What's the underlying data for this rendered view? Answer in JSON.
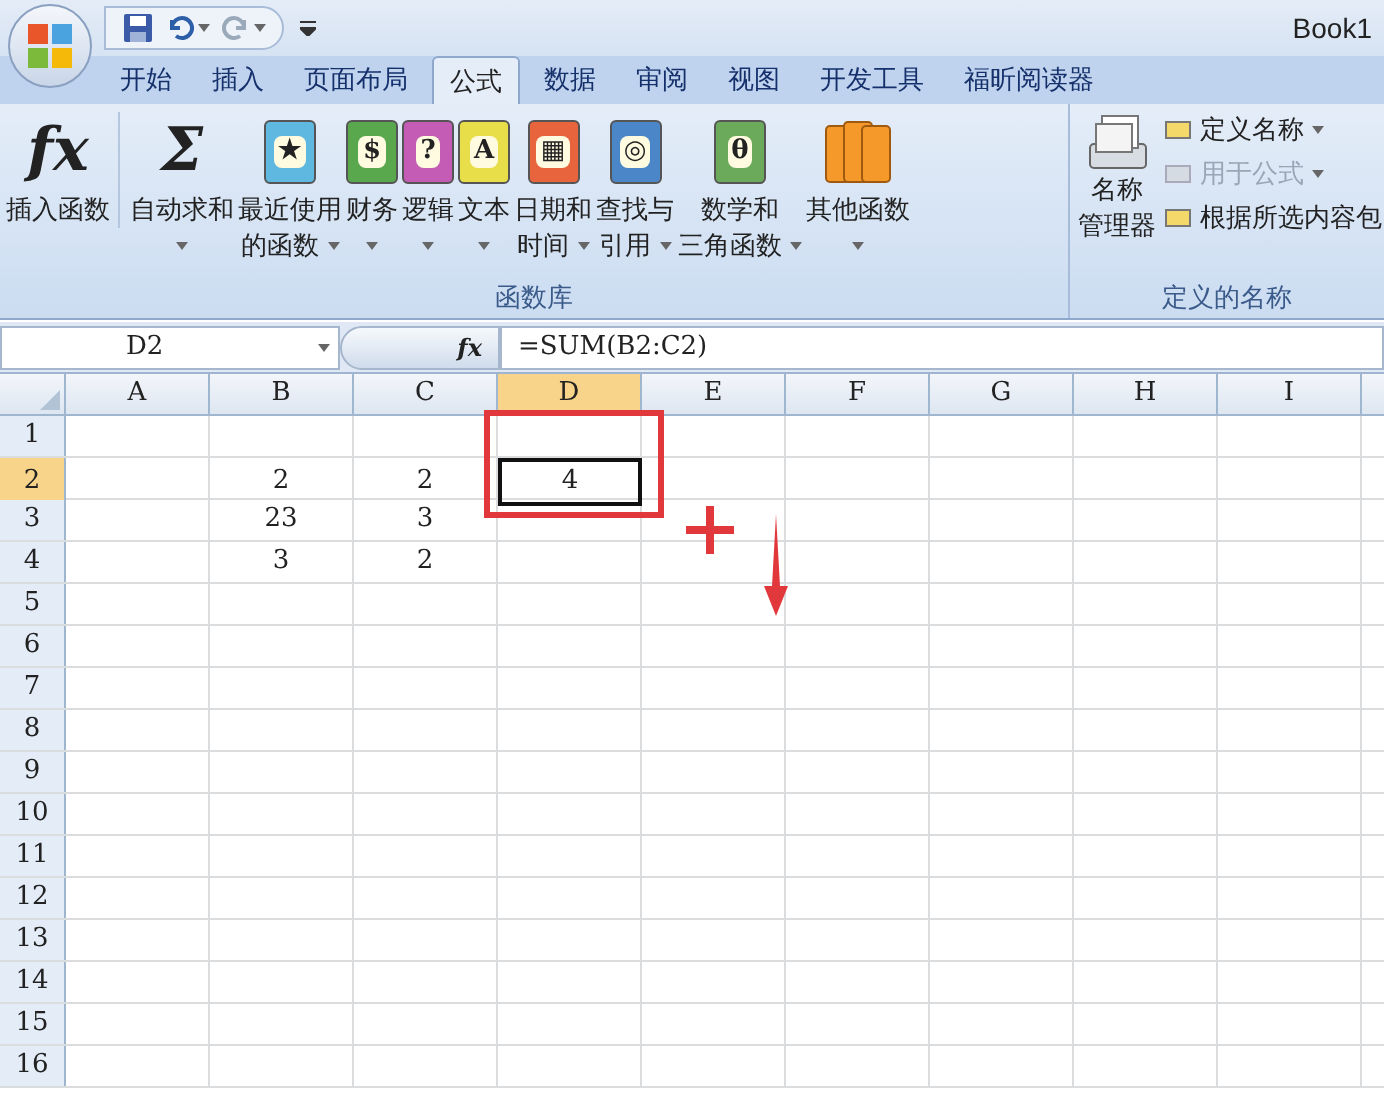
{
  "window": {
    "title": "Book1"
  },
  "quick_access": [
    {
      "kind": "save"
    },
    {
      "kind": "undo",
      "disabled": false
    },
    {
      "kind": "redo",
      "disabled": true
    }
  ],
  "tabs": [
    {
      "label": "开始",
      "selected": false
    },
    {
      "label": "插入",
      "selected": false
    },
    {
      "label": "页面布局",
      "selected": false
    },
    {
      "label": "公式",
      "selected": true
    },
    {
      "label": "数据",
      "selected": false
    },
    {
      "label": "审阅",
      "selected": false
    },
    {
      "label": "视图",
      "selected": false
    },
    {
      "label": "开发工具",
      "selected": false
    },
    {
      "label": "福昕阅读器",
      "selected": false
    }
  ],
  "ribbon": {
    "function_library": {
      "label": "函数库",
      "buttons": [
        {
          "kind": "glyph",
          "glyph": "fx",
          "lines": [
            "插入函数"
          ],
          "dropdown": false
        },
        {
          "kind": "glyph",
          "glyph": "Σ",
          "lines": [
            "自动求和"
          ],
          "dropdown": true
        },
        {
          "kind": "book",
          "color": "#5fb8e0",
          "glyph": "★",
          "lines": [
            "最近使用",
            "的函数"
          ],
          "dropdown": true
        },
        {
          "kind": "book",
          "color": "#5aa84e",
          "glyph": "$",
          "lines": [
            "财务"
          ],
          "dropdown": true
        },
        {
          "kind": "book",
          "color": "#c45bb5",
          "glyph": "?",
          "lines": [
            "逻辑"
          ],
          "dropdown": true
        },
        {
          "kind": "book",
          "color": "#e8de4a",
          "glyph": "A",
          "lines": [
            "文本"
          ],
          "dropdown": true
        },
        {
          "kind": "book",
          "color": "#e8643c",
          "glyph": "▦",
          "lines": [
            "日期和",
            "时间"
          ],
          "dropdown": true
        },
        {
          "kind": "book",
          "color": "#4a86c8",
          "glyph": "◎",
          "lines": [
            "查找与",
            "引用"
          ],
          "dropdown": true
        },
        {
          "kind": "book",
          "color": "#6aaa5a",
          "glyph": "θ",
          "lines": [
            "数学和",
            "三角函数"
          ],
          "dropdown": true
        },
        {
          "kind": "books",
          "color": "#f59a2a",
          "lines": [
            "其他函数"
          ],
          "dropdown": true
        }
      ]
    },
    "defined_names": {
      "label": "定义的名称",
      "manager": {
        "lines": [
          "名称",
          "管理器"
        ]
      },
      "items": [
        {
          "label": "定义名称",
          "dropdown": true,
          "disabled": false
        },
        {
          "label": "用于公式",
          "dropdown": true,
          "disabled": true
        },
        {
          "label": "根据所选内容包",
          "dropdown": false,
          "disabled": false
        }
      ]
    }
  },
  "formula_bar": {
    "name_box": "D2",
    "fx": "fx",
    "formula": "=SUM(B2:C2)"
  },
  "sheet": {
    "columns": [
      {
        "label": "A",
        "selected": false
      },
      {
        "label": "B",
        "selected": false
      },
      {
        "label": "C",
        "selected": false
      },
      {
        "label": "D",
        "selected": true
      },
      {
        "label": "E",
        "selected": false
      },
      {
        "label": "F",
        "selected": false
      },
      {
        "label": "G",
        "selected": false
      },
      {
        "label": "H",
        "selected": false
      },
      {
        "label": "I",
        "selected": false
      }
    ],
    "rows": [
      {
        "label": "1",
        "selected": false,
        "cells": [
          "",
          "",
          "",
          "",
          ""
        ]
      },
      {
        "label": "2",
        "selected": true,
        "cells": [
          "",
          "2",
          "2",
          "4",
          ""
        ]
      },
      {
        "label": "3",
        "selected": false,
        "cells": [
          "",
          "23",
          "3",
          "",
          ""
        ]
      },
      {
        "label": "4",
        "selected": false,
        "cells": [
          "",
          "3",
          "2",
          "",
          ""
        ]
      },
      {
        "label": "5",
        "selected": false,
        "cells": []
      },
      {
        "label": "6",
        "selected": false,
        "cells": []
      },
      {
        "label": "7",
        "selected": false,
        "cells": []
      },
      {
        "label": "8",
        "selected": false,
        "cells": []
      },
      {
        "label": "9",
        "selected": false,
        "cells": []
      },
      {
        "label": "10",
        "selected": false,
        "cells": []
      },
      {
        "label": "11",
        "selected": false,
        "cells": []
      },
      {
        "label": "12",
        "selected": false,
        "cells": []
      },
      {
        "label": "13",
        "selected": false,
        "cells": []
      },
      {
        "label": "14",
        "selected": false,
        "cells": []
      },
      {
        "label": "15",
        "selected": false,
        "cells": []
      },
      {
        "label": "16",
        "selected": false,
        "cells": []
      }
    ]
  }
}
